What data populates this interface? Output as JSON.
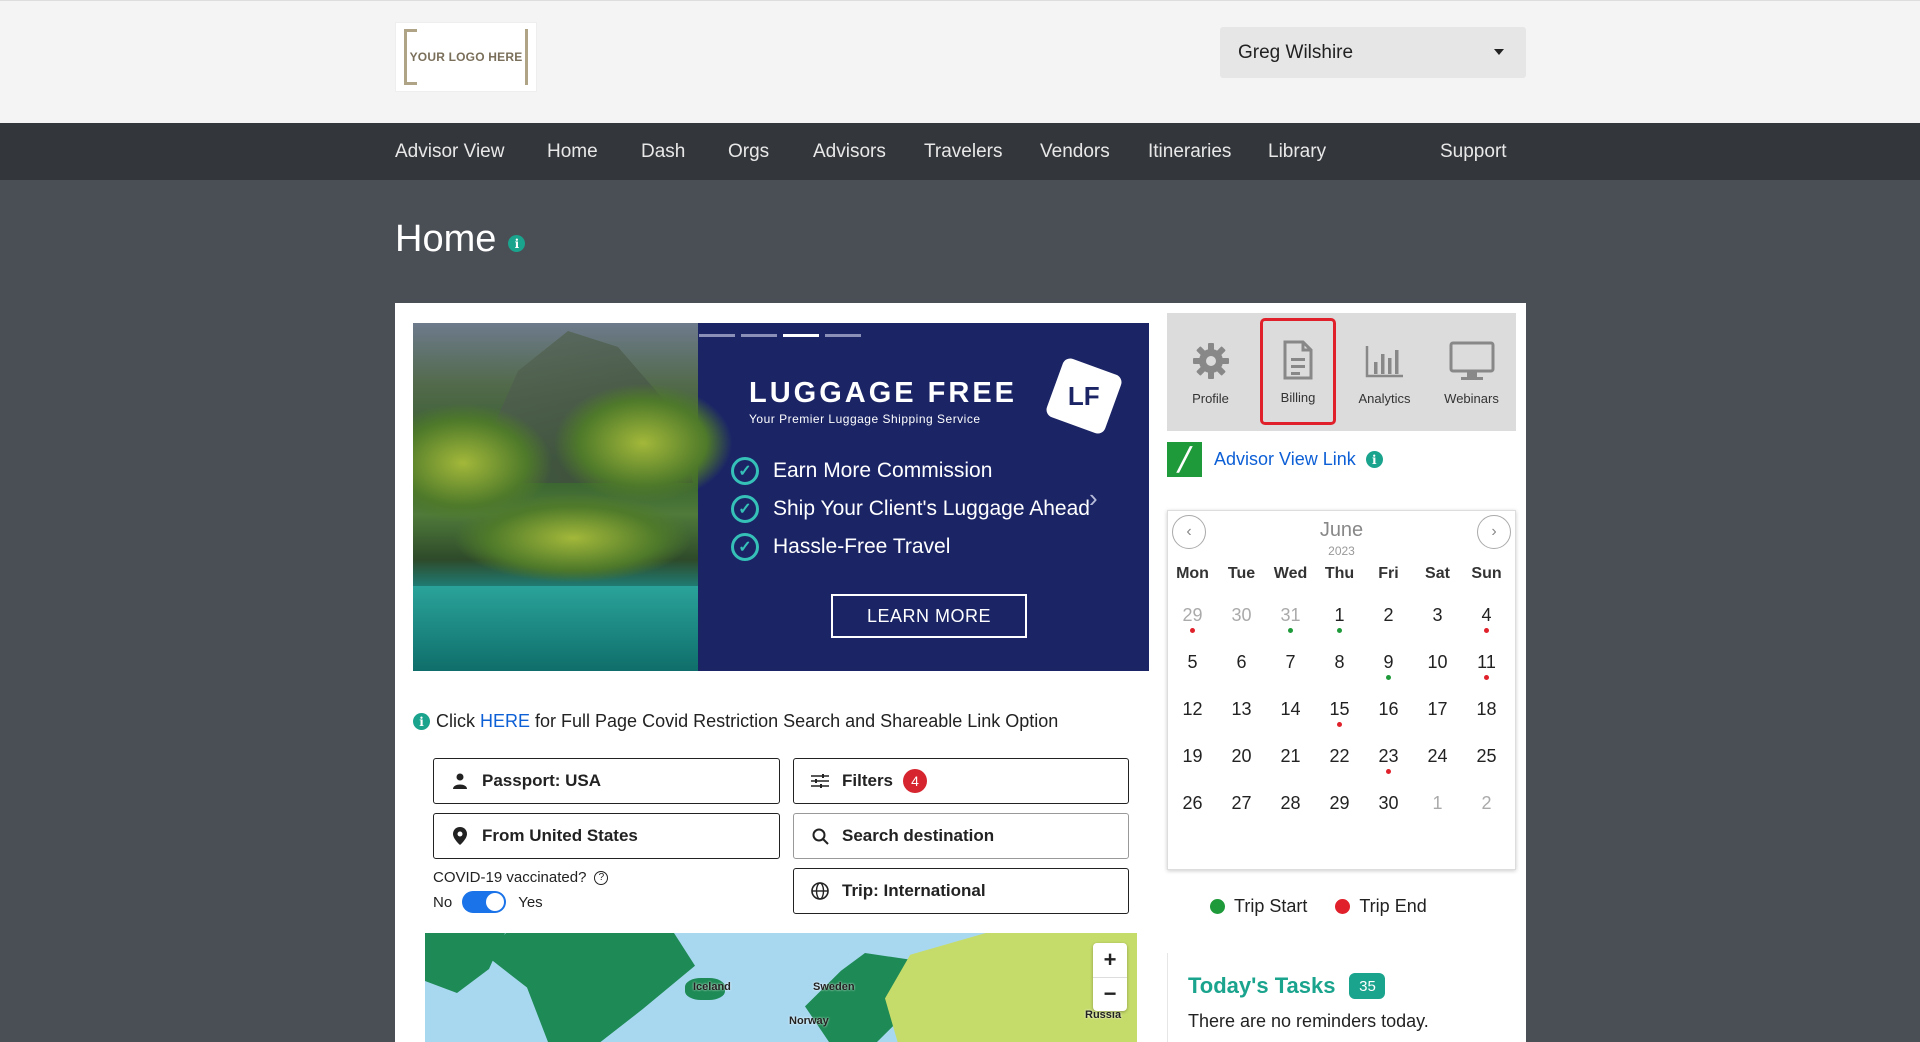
{
  "header": {
    "logo_text": "YOUR LOGO HERE",
    "user_name": "Greg Wilshire"
  },
  "nav": {
    "items": [
      "Advisor View",
      "Home",
      "Dash",
      "Orgs",
      "Advisors",
      "Travelers",
      "Vendors",
      "Itineraries",
      "Library"
    ],
    "support": "Support"
  },
  "page": {
    "title": "Home",
    "info_icon": "i"
  },
  "banner": {
    "brand": "LUGGAGE FREE",
    "tagline": "Your Premier Luggage Shipping Service",
    "logo_mark": "LF",
    "bullets": [
      "Earn More Commission",
      "Ship Your Client's Luggage Ahead",
      "Hassle-Free Travel"
    ],
    "cta": "LEARN MORE",
    "slide_count": 4,
    "active_slide": 3
  },
  "covid": {
    "prefix": "Click",
    "link": "HERE",
    "suffix": "for Full Page Covid Restriction Search and Shareable Link Option"
  },
  "filters": {
    "passport": "Passport: USA",
    "filters_label": "Filters",
    "filters_count": "4",
    "from": "From United States",
    "search_placeholder": "Search destination",
    "trip": "Trip: International",
    "vaccinated_label": "COVID-19 vaccinated?",
    "toggle_no": "No",
    "toggle_yes": "Yes",
    "vaccinated": true
  },
  "map": {
    "labels": [
      "Iceland",
      "Sweden",
      "Norway",
      "Russia"
    ],
    "zoom_in": "+",
    "zoom_out": "−",
    "colors": {
      "water": "#a8d8f0",
      "green": "#1e8a55",
      "lime": "#c6dc6a"
    }
  },
  "quick_tiles": [
    {
      "label": "Profile",
      "icon": "gear-icon"
    },
    {
      "label": "Billing",
      "icon": "document-icon",
      "highlighted": true
    },
    {
      "label": "Analytics",
      "icon": "bar-chart-icon"
    },
    {
      "label": "Webinars",
      "icon": "monitor-icon"
    }
  ],
  "advisor_link": {
    "label": "Advisor View Link"
  },
  "calendar": {
    "month": "June",
    "year": "2023",
    "weekdays": [
      "Mon",
      "Tue",
      "Wed",
      "Thu",
      "Fri",
      "Sat",
      "Sun"
    ],
    "weeks": [
      [
        {
          "d": "29",
          "m": true,
          "dot": "red"
        },
        {
          "d": "30",
          "m": true
        },
        {
          "d": "31",
          "m": true,
          "dot": "green"
        },
        {
          "d": "1",
          "dot": "green"
        },
        {
          "d": "2"
        },
        {
          "d": "3"
        },
        {
          "d": "4",
          "dot": "red"
        }
      ],
      [
        {
          "d": "5"
        },
        {
          "d": "6"
        },
        {
          "d": "7"
        },
        {
          "d": "8"
        },
        {
          "d": "9",
          "dot": "green"
        },
        {
          "d": "10"
        },
        {
          "d": "11",
          "dot": "red"
        }
      ],
      [
        {
          "d": "12"
        },
        {
          "d": "13"
        },
        {
          "d": "14"
        },
        {
          "d": "15",
          "dot": "red"
        },
        {
          "d": "16"
        },
        {
          "d": "17"
        },
        {
          "d": "18"
        }
      ],
      [
        {
          "d": "19"
        },
        {
          "d": "20"
        },
        {
          "d": "21"
        },
        {
          "d": "22"
        },
        {
          "d": "23",
          "dot": "red"
        },
        {
          "d": "24"
        },
        {
          "d": "25"
        }
      ],
      [
        {
          "d": "26"
        },
        {
          "d": "27"
        },
        {
          "d": "28"
        },
        {
          "d": "29"
        },
        {
          "d": "30"
        },
        {
          "d": "1",
          "m": true
        },
        {
          "d": "2",
          "m": true
        }
      ]
    ]
  },
  "legend": {
    "start": "Trip Start",
    "end": "Trip End",
    "start_color": "#1f9a3a",
    "end_color": "#e0202a"
  },
  "tasks": {
    "title": "Today's Tasks",
    "count": "35",
    "empty": "There are no reminders today."
  }
}
